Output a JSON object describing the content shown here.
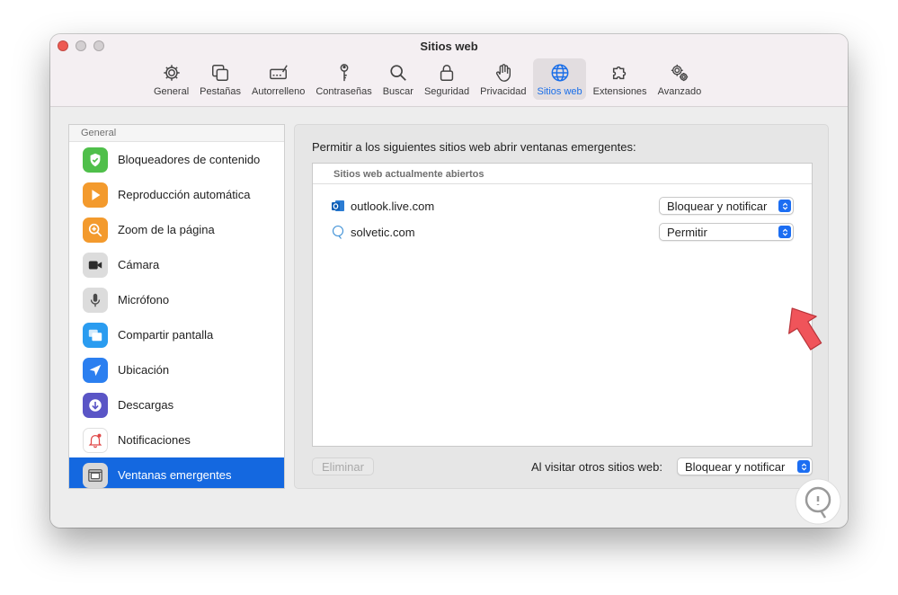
{
  "window": {
    "title": "Sitios web",
    "traffic_lights": [
      "close",
      "minimize",
      "zoom"
    ]
  },
  "toolbar": {
    "items": [
      {
        "label": "General",
        "icon": "gear-icon"
      },
      {
        "label": "Pestañas",
        "icon": "tabs-icon"
      },
      {
        "label": "Autorrelleno",
        "icon": "autofill-icon"
      },
      {
        "label": "Contraseñas",
        "icon": "key-icon"
      },
      {
        "label": "Buscar",
        "icon": "search-icon"
      },
      {
        "label": "Seguridad",
        "icon": "lock-icon"
      },
      {
        "label": "Privacidad",
        "icon": "hand-icon"
      },
      {
        "label": "Sitios web",
        "icon": "globe-icon",
        "active": true
      },
      {
        "label": "Extensiones",
        "icon": "puzzle-icon"
      },
      {
        "label": "Avanzado",
        "icon": "gears-icon"
      }
    ]
  },
  "sidebar": {
    "header": "General",
    "items": [
      {
        "label": "Bloqueadores de contenido",
        "icon": "shield-check-icon",
        "color": "#4fbf4a"
      },
      {
        "label": "Reproducción automática",
        "icon": "play-icon",
        "color": "#f39a2d"
      },
      {
        "label": "Zoom de la página",
        "icon": "zoom-icon",
        "color": "#f39a2d"
      },
      {
        "label": "Cámara",
        "icon": "camera-icon",
        "color": "#3a3a3a"
      },
      {
        "label": "Micrófono",
        "icon": "microphone-icon",
        "color": "#6e6e6e"
      },
      {
        "label": "Compartir pantalla",
        "icon": "screen-share-icon",
        "color": "#2a9cf0"
      },
      {
        "label": "Ubicación",
        "icon": "location-icon",
        "color": "#2b7ff0"
      },
      {
        "label": "Descargas",
        "icon": "download-icon",
        "color": "#5a55c6"
      },
      {
        "label": "Notificaciones",
        "icon": "bell-icon",
        "color": "#ffffff"
      },
      {
        "label": "Ventanas emergentes",
        "icon": "popup-window-icon",
        "color": "#8a8a8a",
        "selected": true
      }
    ]
  },
  "main": {
    "heading": "Permitir a los siguientes sitios web abrir ventanas emergentes:",
    "list_header": "Sitios web actualmente abiertos",
    "sites": [
      {
        "name": "outlook.live.com",
        "icon": "outlook-icon",
        "setting": "Bloquear y notificar"
      },
      {
        "name": "solvetic.com",
        "icon": "solvetic-icon",
        "setting": "Permitir"
      }
    ],
    "remove_button": "Eliminar",
    "other_sites_label": "Al visitar otros sitios web:",
    "other_sites_setting": "Bloquear y notificar"
  },
  "colors": {
    "accent": "#1468e0",
    "arrow": "#f0545a"
  }
}
